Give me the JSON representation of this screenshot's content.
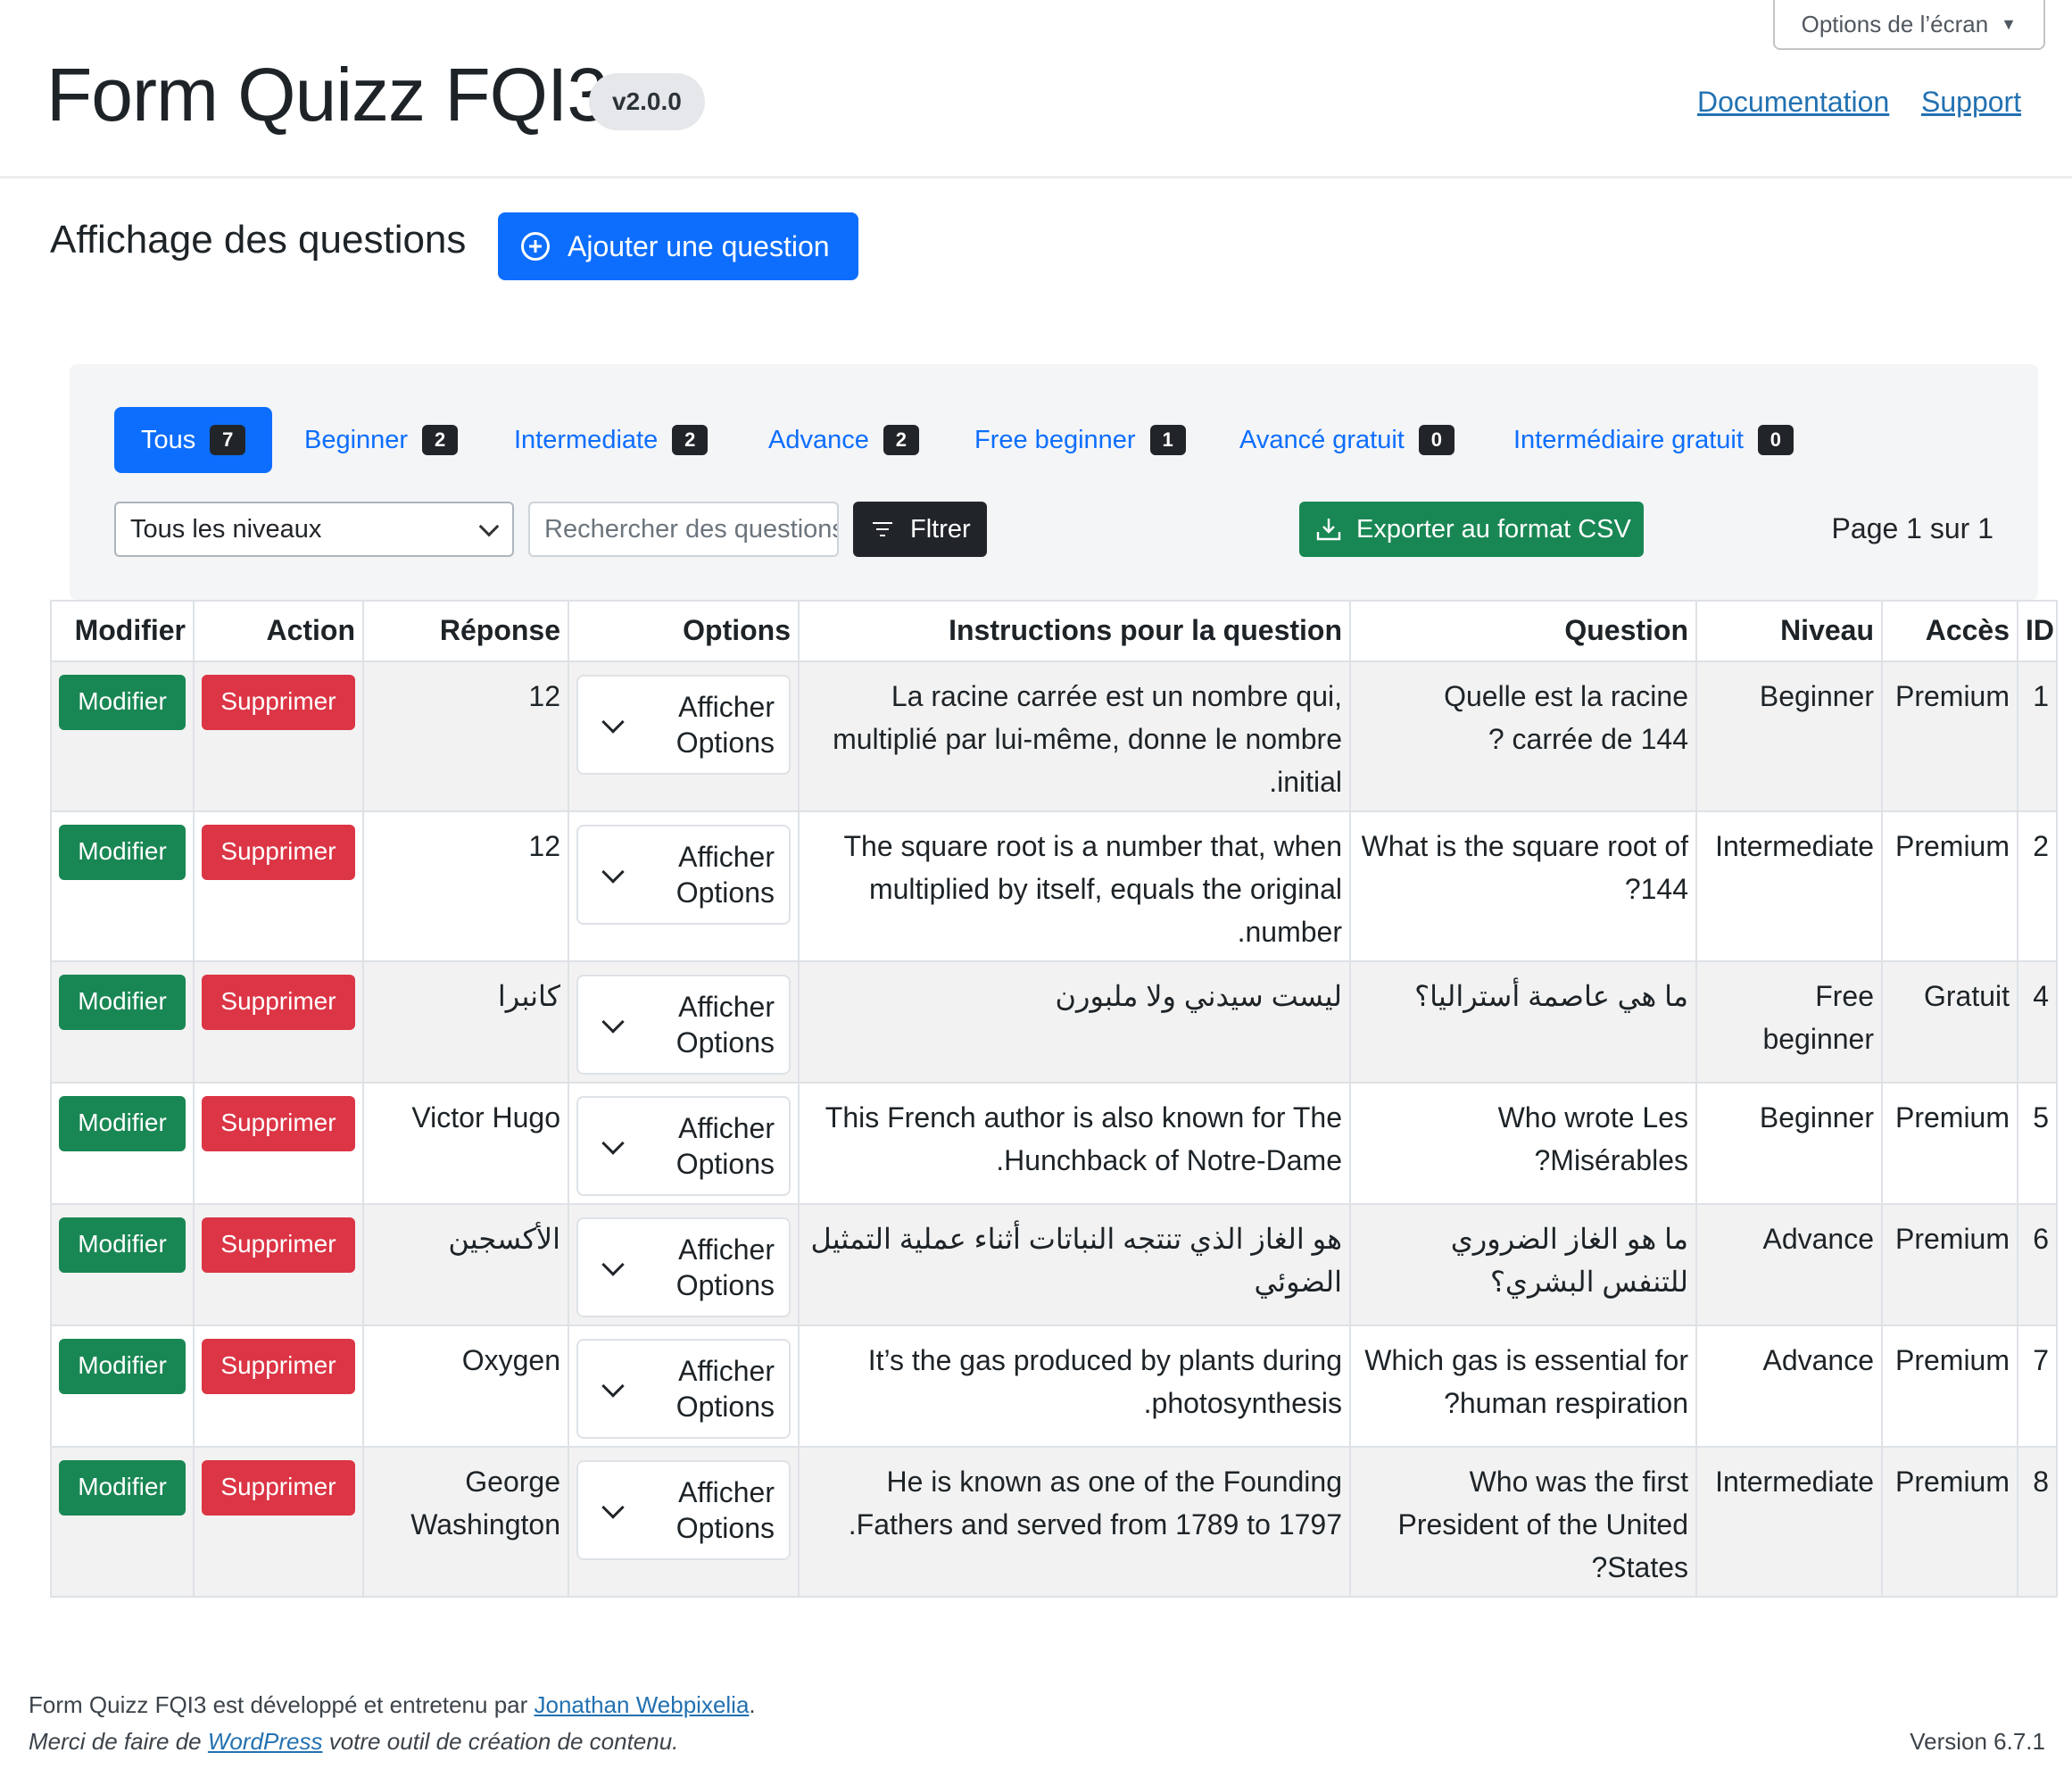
{
  "header": {
    "title": "Form Quizz FQI3",
    "version_badge": "v2.0.0",
    "screen_options": "Options de l’écran",
    "links": [
      "Documentation",
      "Support"
    ]
  },
  "section": {
    "title": "Affichage des questions",
    "add_button": "Ajouter une question"
  },
  "tabs": [
    {
      "label": "Tous",
      "count": "7",
      "active": true
    },
    {
      "label": "Beginner",
      "count": "2"
    },
    {
      "label": "Intermediate",
      "count": "2"
    },
    {
      "label": "Advance",
      "count": "2"
    },
    {
      "label": "Free beginner",
      "count": "1"
    },
    {
      "label": "Avancé gratuit",
      "count": "0"
    },
    {
      "label": "Intermédiaire gratuit",
      "count": "0"
    }
  ],
  "filters": {
    "level_select": "Tous les niveaux",
    "search_placeholder": "Rechercher des questions",
    "filter_button": "Fltrer",
    "export_button": "Exporter au format CSV",
    "page_info": "Page 1 sur 1"
  },
  "table": {
    "headers": [
      "Modifier",
      "Action",
      "Réponse",
      "Options",
      "Instructions pour la question",
      "Question",
      "Niveau",
      "Accès",
      "ID"
    ],
    "edit_label": "Modifier",
    "delete_label": "Supprimer",
    "options_label_line1": "Afficher",
    "options_label_line2": "Options",
    "rows": [
      {
        "answer": "12",
        "instructions": "La racine carrée est un nombre qui, multiplié par lui-même, donne le nombre initial.",
        "question": "Quelle est la racine carrée de 144 ?",
        "level": "Beginner",
        "access": "Premium",
        "id": "1"
      },
      {
        "answer": "12",
        "instructions": "The square root is a number that, when multiplied by itself, equals the original number.",
        "question": "What is the square root of 144?",
        "level": "Intermediate",
        "access": "Premium",
        "id": "2"
      },
      {
        "answer": "كانبرا",
        "instructions": "ليست سيدني ولا ملبورن",
        "question": "ما هي عاصمة أستراليا؟",
        "level": "Free beginner",
        "access": "Gratuit",
        "id": "4"
      },
      {
        "answer": "Victor Hugo",
        "instructions": "This French author is also known for The Hunchback of Notre-Dame.",
        "question": "Who wrote Les Misérables?",
        "level": "Beginner",
        "access": "Premium",
        "id": "5"
      },
      {
        "answer": "الأكسجين",
        "instructions": "هو الغاز الذي تنتجه النباتات أثناء عملية التمثيل الضوئي",
        "question": "ما هو الغاز الضروري للتنفس البشري؟",
        "level": "Advance",
        "access": "Premium",
        "id": "6"
      },
      {
        "answer": "Oxygen",
        "instructions": "It’s the gas produced by plants during photosynthesis.",
        "question": "Which gas is essential for human respiration?",
        "level": "Advance",
        "access": "Premium",
        "id": "7"
      },
      {
        "answer": "George Washington",
        "instructions": "He is known as one of the Founding Fathers and served from 1789 to 1797.",
        "question": "Who was the first President of the United States?",
        "level": "Intermediate",
        "access": "Premium",
        "id": "8"
      }
    ]
  },
  "footer": {
    "credit_prefix": "Form Quizz FQI3 est développé et entretenu par",
    "credit_link": "Jonathan Webpixelia",
    "credit_suffix": ".",
    "thanks_prefix": "Merci de faire de",
    "thanks_link": "WordPress",
    "thanks_suffix": "votre outil de création de contenu.",
    "version": "Version 6.7.1"
  },
  "colors": {
    "primary": "#0d6efd",
    "success": "#198754",
    "danger": "#dc3545",
    "dark": "#212529",
    "wp_link": "#2271b1"
  }
}
